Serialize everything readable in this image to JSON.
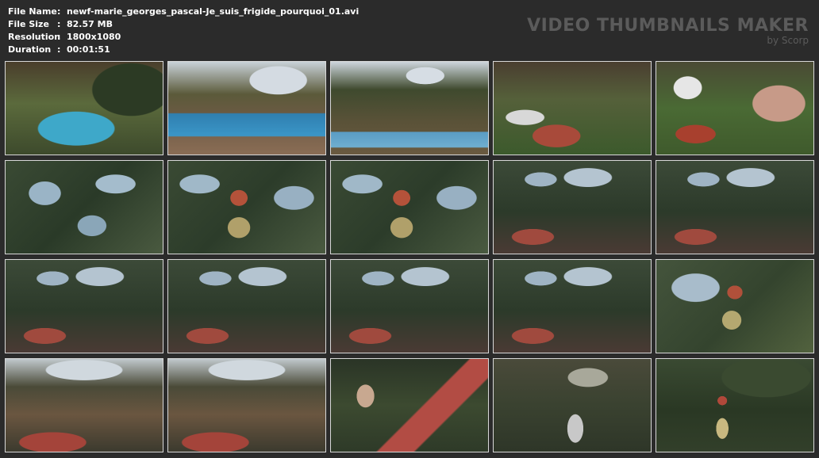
{
  "header": {
    "info": [
      {
        "key": "File Name",
        "sep": ":",
        "value": "newf-marie_georges_pascal-Je_suis_frigide_pourquoi_01.avi"
      },
      {
        "key": "File Size",
        "sep": ":",
        "value": "82.57 MB"
      },
      {
        "key": "Resolution",
        "sep": ":",
        "value": "1800x1080"
      },
      {
        "key": "Duration",
        "sep": ":",
        "value": "00:01:51"
      }
    ],
    "brand_title": "VIDEO THUMBNAILS MAKER",
    "brand_subtitle": "by Scorp"
  }
}
